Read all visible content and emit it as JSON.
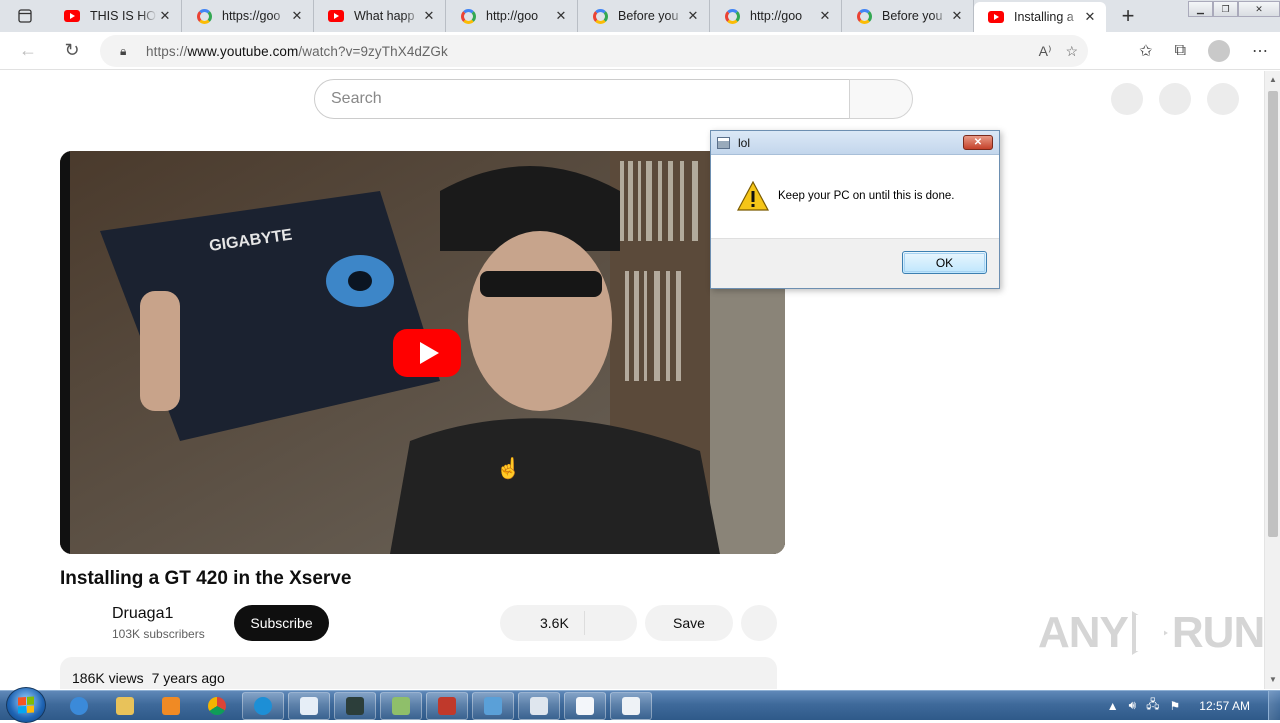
{
  "browser": {
    "tabs": [
      {
        "title": "THIS IS HOW",
        "favicon": "youtube-icon"
      },
      {
        "title": "https://goo",
        "favicon": "google-icon"
      },
      {
        "title": "What happ",
        "favicon": "youtube-icon"
      },
      {
        "title": "http://goo",
        "favicon": "google-icon"
      },
      {
        "title": "Before you",
        "favicon": "google-icon"
      },
      {
        "title": "http://goo",
        "favicon": "google-icon"
      },
      {
        "title": "Before you",
        "favicon": "google-icon"
      },
      {
        "title": "Installing a",
        "favicon": "youtube-icon",
        "active": true
      }
    ],
    "url_prefix": "https://",
    "url_domain": "www.youtube.com",
    "url_path": "/watch?v=9zyThX4dZGk"
  },
  "youtube": {
    "search_placeholder": "Search",
    "video_title": "Installing a GT 420 in the Xserve",
    "channel_name": "Druaga1",
    "subscribers": "103K subscribers",
    "subscribe_label": "Subscribe",
    "like_count": "3.6K",
    "save_label": "Save",
    "views": "186K views",
    "age": "7 years ago",
    "thumbnail_brand": "GIGABYTE"
  },
  "dialog": {
    "title": "lol",
    "message": "Keep your PC on until this is done.",
    "ok_label": "OK",
    "icon": "warning-icon"
  },
  "watermark": {
    "left": "ANY",
    "right": "RUN"
  },
  "taskbar": {
    "clock": "12:57 AM",
    "items": [
      "ie-icon",
      "explorer-icon",
      "media-player-icon",
      "chrome-icon",
      "edge-icon",
      "notepad-icon",
      "terminal-icon",
      "tool-icon",
      "archive-icon",
      "monitor-icon",
      "feather-icon",
      "document-icon",
      "calculator-icon"
    ]
  },
  "colors": {
    "youtube_red": "#ff0000",
    "taskbar_blue": "#3f6a9b",
    "dialog_title": "#c3d6ec"
  }
}
